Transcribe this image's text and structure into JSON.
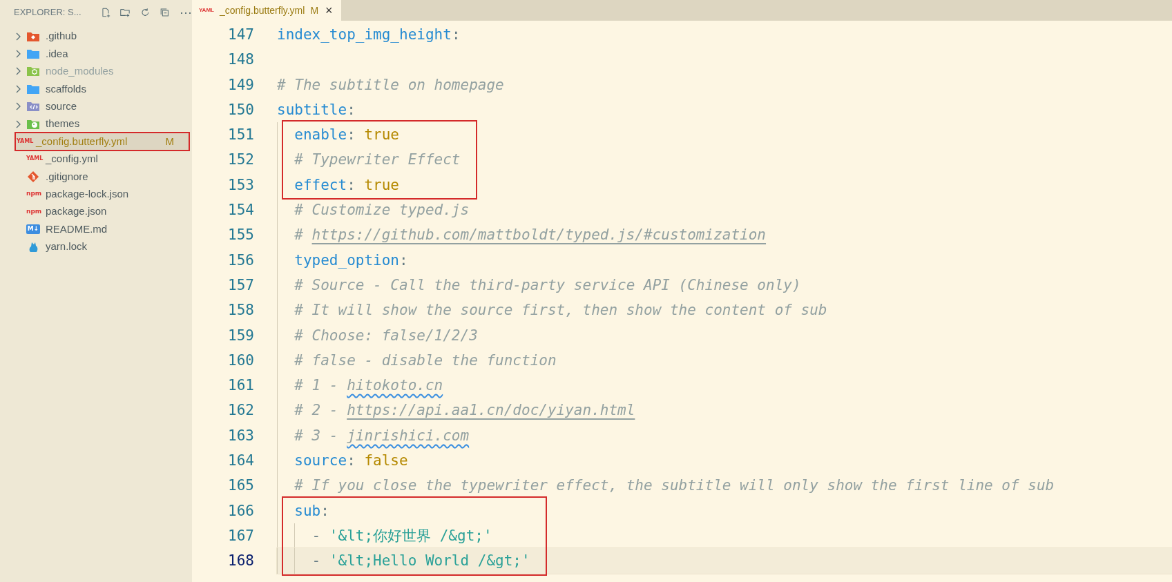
{
  "sidebar": {
    "title": "EXPLORER: S...",
    "more": "⋯",
    "items": [
      {
        "kind": "folder",
        "label": ".github",
        "dimmed": false,
        "selected": false,
        "boxed": false
      },
      {
        "kind": "folder",
        "label": ".idea",
        "dimmed": false,
        "selected": false,
        "boxed": false
      },
      {
        "kind": "folder",
        "label": "node_modules",
        "dimmed": true,
        "selected": false,
        "boxed": false
      },
      {
        "kind": "folder",
        "label": "scaffolds",
        "dimmed": false,
        "selected": false,
        "boxed": false
      },
      {
        "kind": "folder",
        "label": "source",
        "dimmed": false,
        "selected": false,
        "boxed": false
      },
      {
        "kind": "folder",
        "label": "themes",
        "dimmed": false,
        "selected": false,
        "boxed": false
      },
      {
        "kind": "file",
        "icon_text": "YAML",
        "label": "_config.butterfly.yml",
        "badge": "M",
        "dimmed": false,
        "selected": true,
        "boxed": true
      },
      {
        "kind": "file",
        "icon_text": "YAML",
        "label": "_config.yml",
        "dimmed": false,
        "selected": false,
        "boxed": false
      },
      {
        "kind": "file",
        "label": ".gitignore",
        "dimmed": false,
        "selected": false,
        "boxed": false
      },
      {
        "kind": "file",
        "icon_text": "npm",
        "label": "package-lock.json",
        "dimmed": false,
        "selected": false,
        "boxed": false
      },
      {
        "kind": "file",
        "icon_text": "npm",
        "label": "package.json",
        "dimmed": false,
        "selected": false,
        "boxed": false
      },
      {
        "kind": "file",
        "icon_text": "M↓",
        "label": "README.md",
        "dimmed": false,
        "selected": false,
        "boxed": false
      },
      {
        "kind": "file",
        "label": "yarn.lock",
        "dimmed": false,
        "selected": false,
        "boxed": false
      }
    ]
  },
  "tab": {
    "icon_text": "YAML",
    "label": "_config.butterfly.yml",
    "badge": "M",
    "close": "×",
    "selected": true
  },
  "editor": {
    "lines": [
      {
        "kind": "line",
        "number": "147",
        "current": false,
        "tokens": [
          {
            "kind": "key",
            "text": "index_top_img_height"
          },
          {
            "kind": "punct",
            "text": ":"
          }
        ]
      },
      {
        "kind": "line",
        "number": "148",
        "current": false
      },
      {
        "kind": "line",
        "number": "149",
        "current": false,
        "tokens": [
          {
            "kind": "comment",
            "text": "# The subtitle on homepage"
          }
        ]
      },
      {
        "kind": "line",
        "number": "150",
        "current": false,
        "tokens": [
          {
            "kind": "key",
            "text": "subtitle"
          },
          {
            "kind": "punct",
            "text": ":"
          }
        ],
        "children": [
          {
            "kind": "box",
            "lines": [
              {
                "kind": "line",
                "number": "151",
                "current": false,
                "tokens": [
                  {
                    "kind": "key",
                    "text": "enable"
                  },
                  {
                    "kind": "punct",
                    "text": ": "
                  },
                  {
                    "kind": "bool",
                    "text": "true"
                  }
                ]
              },
              {
                "kind": "line",
                "number": "152",
                "current": false,
                "tokens": [
                  {
                    "kind": "comment",
                    "text": "# Typewriter Effect"
                  }
                ]
              },
              {
                "kind": "line",
                "number": "153",
                "current": false,
                "tokens": [
                  {
                    "kind": "key",
                    "text": "effect"
                  },
                  {
                    "kind": "punct",
                    "text": ": "
                  },
                  {
                    "kind": "bool",
                    "text": "true"
                  }
                ]
              }
            ]
          },
          {
            "kind": "line",
            "number": "154",
            "current": false,
            "tokens": [
              {
                "kind": "comment",
                "text": "# Customize typed.js"
              }
            ]
          },
          {
            "kind": "line",
            "number": "155",
            "current": false,
            "tokens": [
              {
                "kind": "comment",
                "text": "# "
              },
              {
                "kind": "link",
                "text": "https://github.com/mattboldt/typed.js/#customization"
              }
            ]
          },
          {
            "kind": "line",
            "number": "156",
            "current": false,
            "tokens": [
              {
                "kind": "key",
                "text": "typed_option"
              },
              {
                "kind": "punct",
                "text": ":"
              }
            ]
          },
          {
            "kind": "line",
            "number": "157",
            "current": false,
            "tokens": [
              {
                "kind": "comment",
                "text": "# Source - Call the third-party service API (Chinese only)"
              }
            ]
          },
          {
            "kind": "line",
            "number": "158",
            "current": false,
            "tokens": [
              {
                "kind": "comment",
                "text": "# It will show the source first, then show the content of sub"
              }
            ]
          },
          {
            "kind": "line",
            "number": "159",
            "current": false,
            "tokens": [
              {
                "kind": "comment",
                "text": "# Choose: false/1/2/3"
              }
            ]
          },
          {
            "kind": "line",
            "number": "160",
            "current": false,
            "tokens": [
              {
                "kind": "comment",
                "text": "# false - disable the function"
              }
            ]
          },
          {
            "kind": "line",
            "number": "161",
            "current": false,
            "tokens": [
              {
                "kind": "comment",
                "text": "# 1 - "
              },
              {
                "kind": "spell",
                "text": "hitokoto.cn"
              }
            ]
          },
          {
            "kind": "line",
            "number": "162",
            "current": false,
            "tokens": [
              {
                "kind": "comment",
                "text": "# 2 - "
              },
              {
                "kind": "link",
                "text": "https://api.aa1.cn/doc/yiyan.html"
              }
            ]
          },
          {
            "kind": "line",
            "number": "163",
            "current": false,
            "tokens": [
              {
                "kind": "comment",
                "text": "# 3 - "
              },
              {
                "kind": "spell",
                "text": "jinrishici.com"
              }
            ]
          },
          {
            "kind": "line",
            "number": "164",
            "current": false,
            "tokens": [
              {
                "kind": "key",
                "text": "source"
              },
              {
                "kind": "punct",
                "text": ": "
              },
              {
                "kind": "bool",
                "text": "false"
              }
            ]
          },
          {
            "kind": "line",
            "number": "165",
            "current": false,
            "tokens": [
              {
                "kind": "comment",
                "text": "# If you close the typewriter effect, the subtitle will only show the first line of sub"
              }
            ]
          },
          {
            "kind": "box",
            "lines": [
              {
                "kind": "line",
                "number": "166",
                "current": false,
                "tokens": [
                  {
                    "kind": "key",
                    "text": "sub"
                  },
                  {
                    "kind": "punct",
                    "text": ":"
                  }
                ],
                "children": [
                  {
                    "kind": "line",
                    "number": "167",
                    "current": false,
                    "tokens": [
                      {
                        "kind": "punct",
                        "text": "- "
                      },
                      {
                        "kind": "string",
                        "text": "'&lt;你好世界 /&gt;'"
                      }
                    ]
                  },
                  {
                    "kind": "line",
                    "number": "168",
                    "current": true,
                    "tokens": [
                      {
                        "kind": "punct",
                        "text": "- "
                      },
                      {
                        "kind": "string",
                        "text": "'&lt;Hello World /&gt;'"
                      }
                    ]
                  }
                ]
              }
            ]
          }
        ]
      }
    ]
  }
}
